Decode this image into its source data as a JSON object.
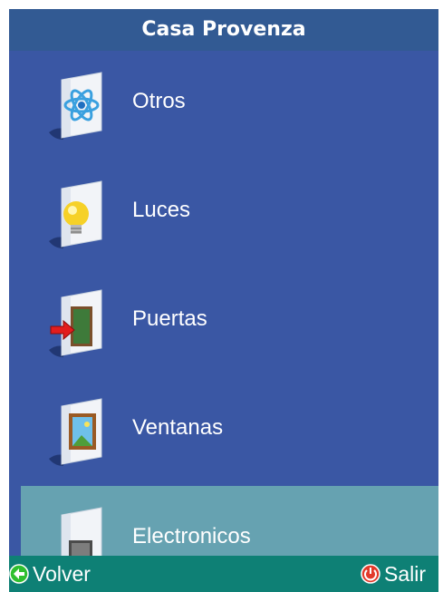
{
  "title": "Casa Provenza",
  "menu": {
    "items": [
      {
        "label": "Otros",
        "icon": "atom-folder-icon"
      },
      {
        "label": "Luces",
        "icon": "lightbulb-folder-icon"
      },
      {
        "label": "Puertas",
        "icon": "door-folder-icon"
      },
      {
        "label": "Ventanas",
        "icon": "window-folder-icon"
      },
      {
        "label": "Electronicos",
        "icon": "electronics-folder-icon"
      }
    ],
    "selected_index": 4
  },
  "softkeys": {
    "back_label": "Volver",
    "exit_label": "Salir"
  },
  "colors": {
    "background": "#3a57a4",
    "titlebar": "#325a93",
    "selection": "#66a2b1",
    "bottombar": "#0e8075"
  }
}
